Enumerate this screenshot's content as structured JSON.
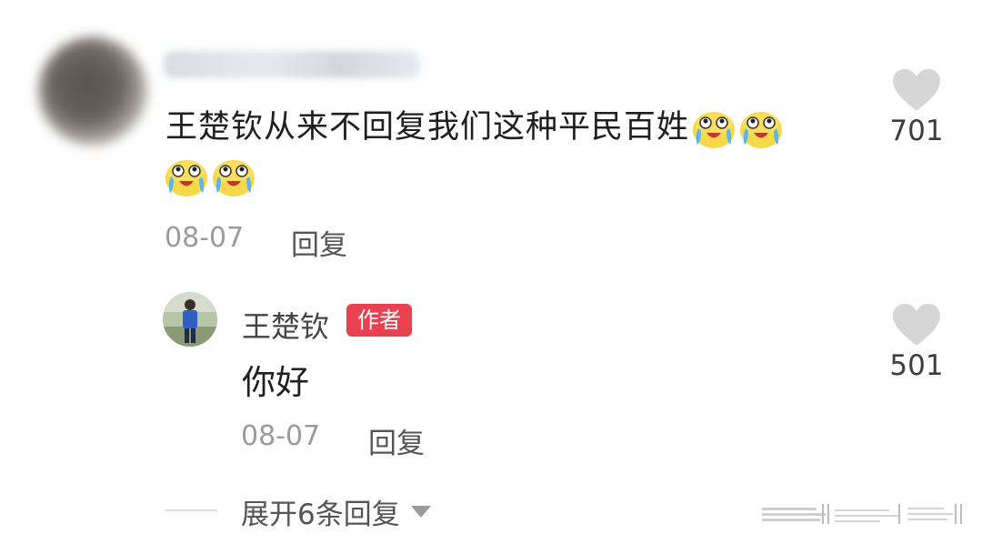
{
  "comment": {
    "text": "王楚钦从来不回复我们这种平民百姓",
    "emoji_icons": [
      "crying-laughing-face-icon",
      "crying-laughing-face-icon",
      "crying-laughing-face-icon",
      "crying-laughing-face-icon"
    ],
    "date": "08-07",
    "reply_label": "回复",
    "likes": "701"
  },
  "reply": {
    "author": "王楚钦",
    "badge": "作者",
    "text": "你好",
    "date": "08-07",
    "reply_label": "回复",
    "likes": "501"
  },
  "expand_label": "展开6条回复",
  "colors": {
    "badge_bg": "#e9414f",
    "like_heart": "#d6d6d6",
    "meta_text": "#9b9b9b"
  }
}
